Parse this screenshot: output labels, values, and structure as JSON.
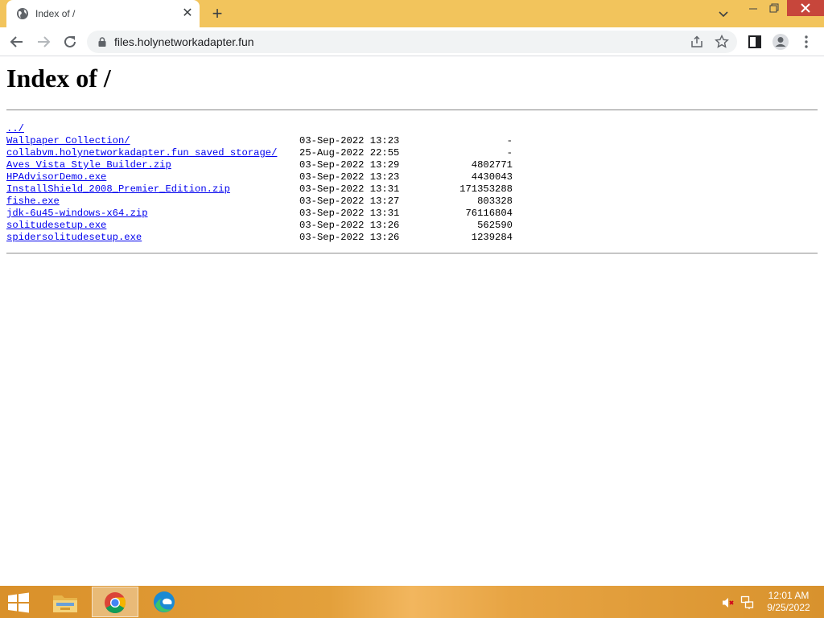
{
  "browser": {
    "tab_title": "Index of /",
    "url": "files.holynetworkadapter.fun"
  },
  "page": {
    "heading": "Index of /",
    "parent_link": "../",
    "entries": [
      {
        "name": "Wallpaper Collection/",
        "date": "03-Sep-2022 13:23",
        "size": "-"
      },
      {
        "name": "collabvm.holynetworkadapter.fun saved storage/",
        "date": "25-Aug-2022 22:55",
        "size": "-"
      },
      {
        "name": "Aves Vista Style Builder.zip",
        "date": "03-Sep-2022 13:29",
        "size": "4802771"
      },
      {
        "name": "HPAdvisorDemo.exe",
        "date": "03-Sep-2022 13:23",
        "size": "4430043"
      },
      {
        "name": "InstallShield_2008_Premier_Edition.zip",
        "date": "03-Sep-2022 13:31",
        "size": "171353288"
      },
      {
        "name": "fishe.exe",
        "date": "03-Sep-2022 13:27",
        "size": "803328"
      },
      {
        "name": "jdk-6u45-windows-x64.zip",
        "date": "03-Sep-2022 13:31",
        "size": "76116804"
      },
      {
        "name": "solitudesetup.exe",
        "date": "03-Sep-2022 13:26",
        "size": "562590"
      },
      {
        "name": "spidersolitudesetup.exe",
        "date": "03-Sep-2022 13:26",
        "size": "1239284"
      }
    ]
  },
  "taskbar": {
    "time": "12:01 AM",
    "date": "9/25/2022"
  },
  "icons": {
    "favicon": "globe-icon",
    "tab_close": "close-icon",
    "new_tab": "plus-icon",
    "tab_search": "chevron-down-icon",
    "minimize": "minimize-icon",
    "restore": "restore-icon",
    "close": "close-icon",
    "back": "back-arrow-icon",
    "forward": "forward-arrow-icon",
    "reload": "reload-icon",
    "lock": "lock-icon",
    "share": "share-icon",
    "bookmark": "star-icon",
    "side_panel": "side-panel-icon",
    "profile": "profile-icon",
    "menu": "kebab-menu-icon",
    "start": "windows-logo-icon",
    "explorer": "folder-icon",
    "chrome": "chrome-icon",
    "edge": "edge-icon",
    "volume": "volume-muted-icon",
    "network": "network-icon"
  },
  "colors": {
    "tabstrip": "#f2c45c",
    "link": "#0000ee",
    "close_button": "#c7463b"
  }
}
